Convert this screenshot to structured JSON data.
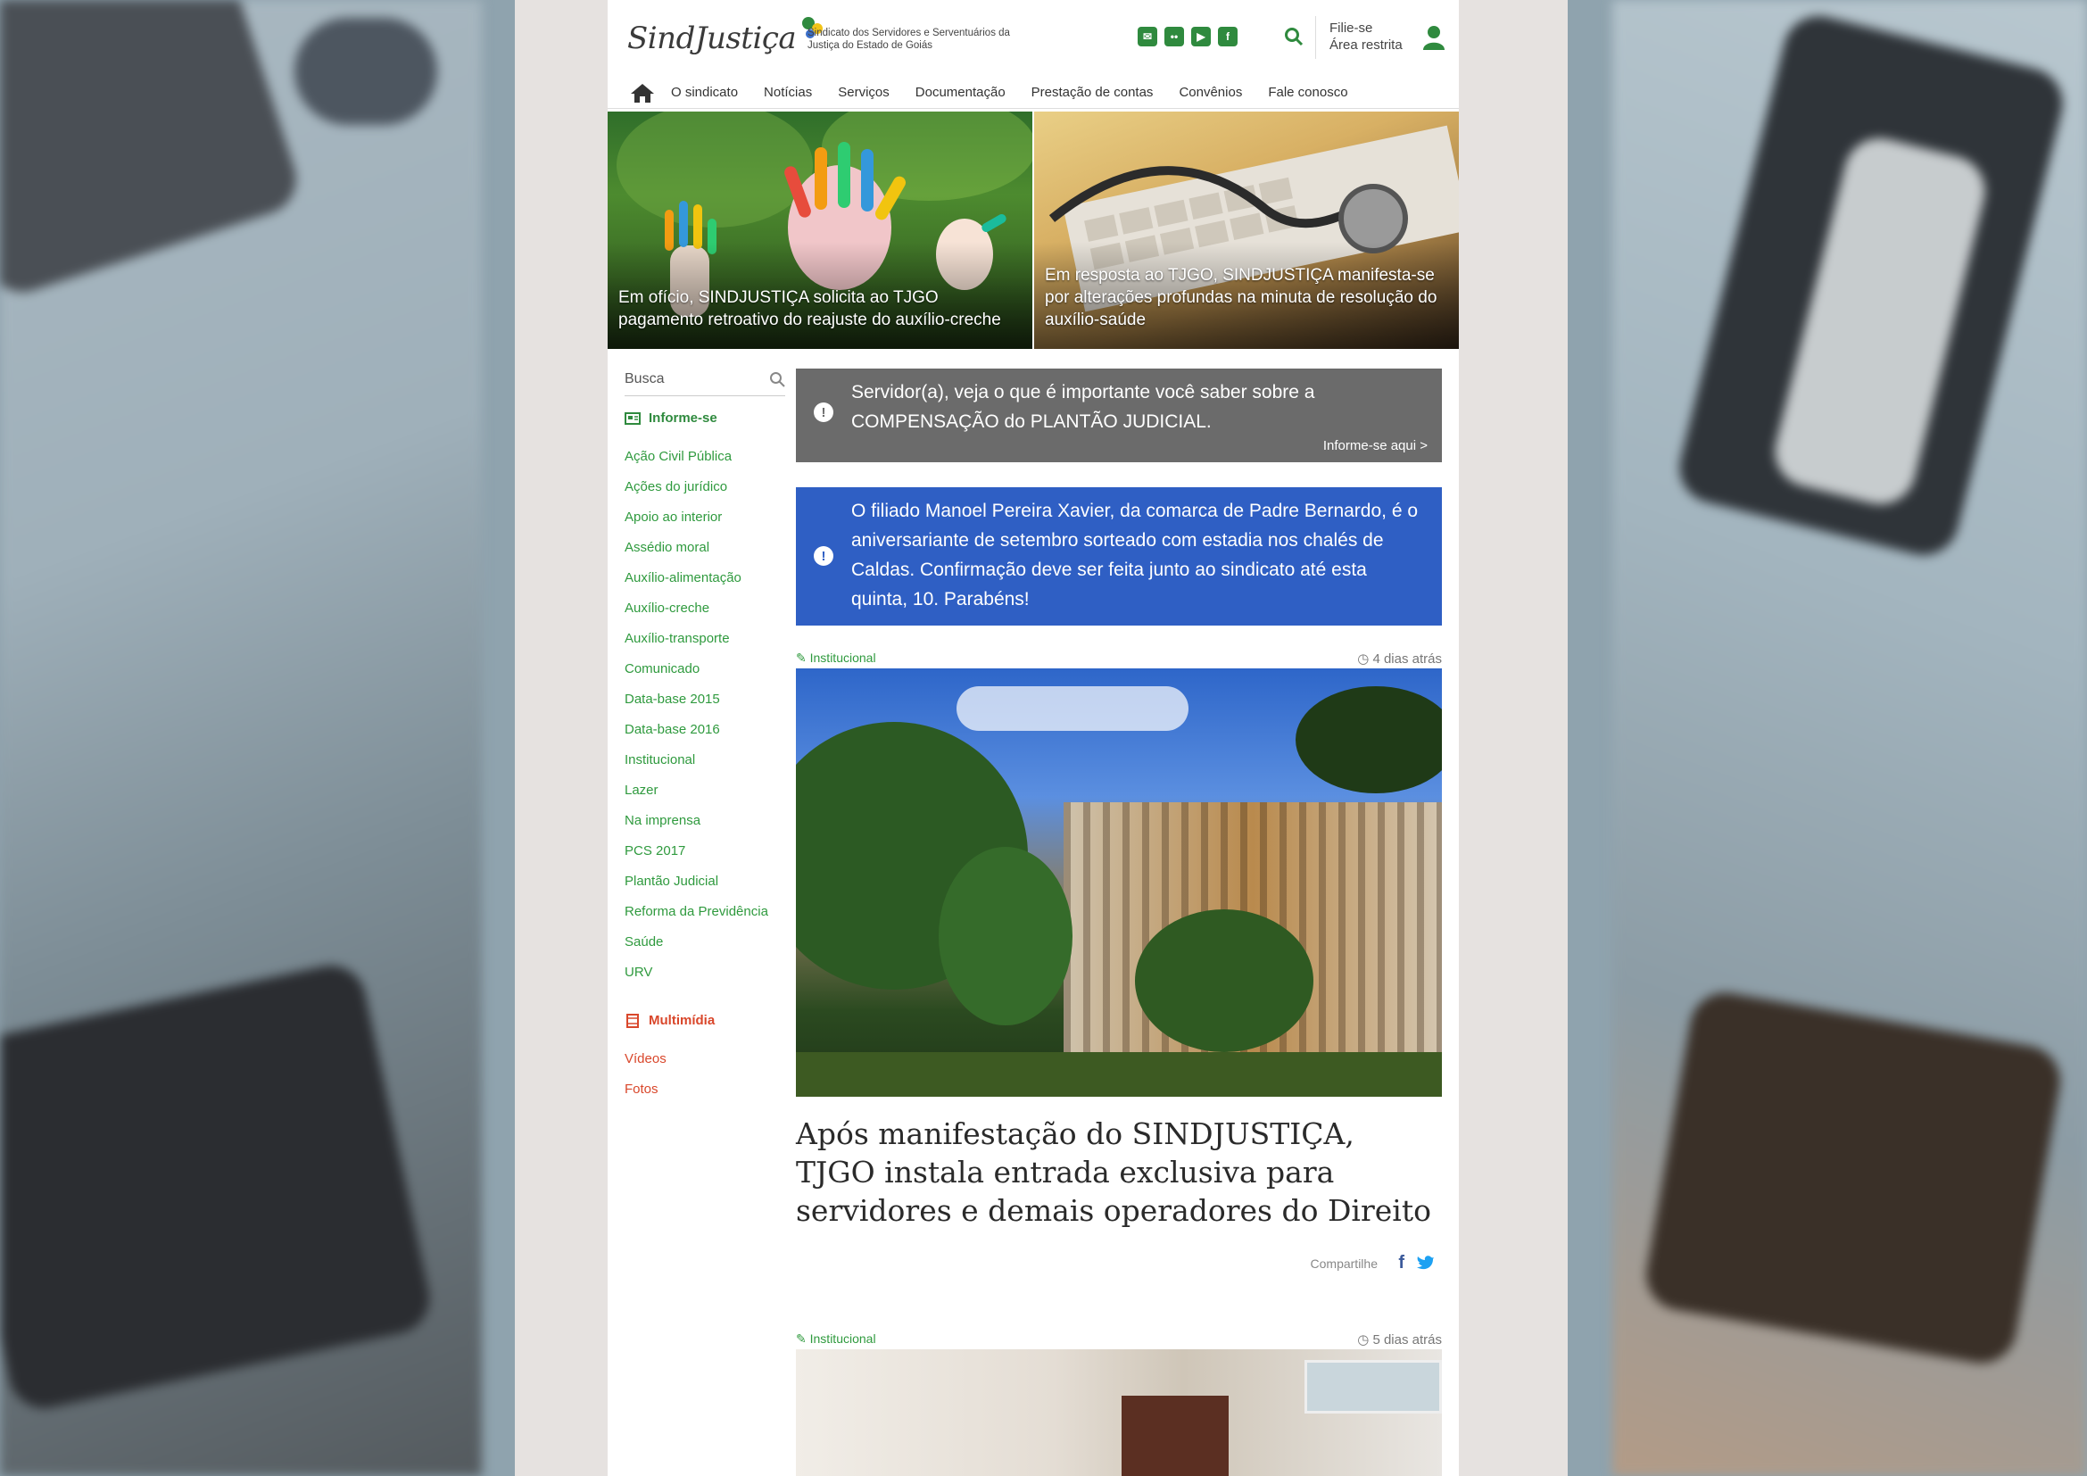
{
  "brand": {
    "logo_text": "SindJustiça",
    "tagline": "Sindicato dos Servidores e Serventuários da Justiça do Estado de Goiás",
    "accent_green": "#2f8a3e",
    "accent_red": "#d9472b",
    "accent_blue": "#2f5fc4"
  },
  "header": {
    "social_icons": [
      "mail-icon",
      "flickr-icon",
      "youtube-icon",
      "facebook-icon"
    ],
    "join_label": "Filie-se",
    "restricted_label": "Área restrita"
  },
  "nav": {
    "items": [
      "O sindicato",
      "Notícias",
      "Serviços",
      "Documentação",
      "Prestação de contas",
      "Convênios",
      "Fale conosco"
    ]
  },
  "hero": [
    {
      "caption": "Em ofício, SINDJUSTIÇA solicita ao TJGO pagamento retroativo do reajuste do auxílio-creche"
    },
    {
      "caption": "Em resposta ao TJGO, SINDJUSTIÇA manifesta-se por alterações profundas na minuta de resolução do auxílio-saúde"
    }
  ],
  "sidebar": {
    "search_placeholder": "Busca",
    "informe_title": "Informe-se",
    "informe_items": [
      "Ação Civil Pública",
      "Ações do jurídico",
      "Apoio ao interior",
      "Assédio moral",
      "Auxílio-alimentação",
      "Auxílio-creche",
      "Auxílio-transporte",
      "Comunicado",
      "Data-base 2015",
      "Data-base 2016",
      "Institucional",
      "Lazer",
      "Na imprensa",
      "PCS 2017",
      "Plantão Judicial",
      "Reforma da Previdência",
      "Saúde",
      "URV"
    ],
    "multimedia_title": "Multimídia",
    "multimedia_items": [
      "Vídeos",
      "Fotos"
    ]
  },
  "notices": {
    "gray_text": "Servidor(a), veja o que é importante você saber sobre a COMPENSAÇÃO do PLANTÃO JUDICIAL.",
    "gray_link": "Informe-se aqui >",
    "blue_text": "O filiado Manoel Pereira Xavier, da comarca de Padre Bernardo, é o aniversariante de setembro sorteado com estadia nos chalés de Caldas. Confirmação deve ser feita junto ao sindicato até esta quinta, 10. Parabéns!"
  },
  "articles": [
    {
      "category": "Institucional",
      "time": "4 dias atrás",
      "title": "Após manifestação do SINDJUSTIÇA, TJGO instala entrada exclusiva para servidores e demais operadores do Direito",
      "share_label": "Compartilhe"
    },
    {
      "category": "Institucional",
      "time": "5 dias atrás"
    }
  ]
}
